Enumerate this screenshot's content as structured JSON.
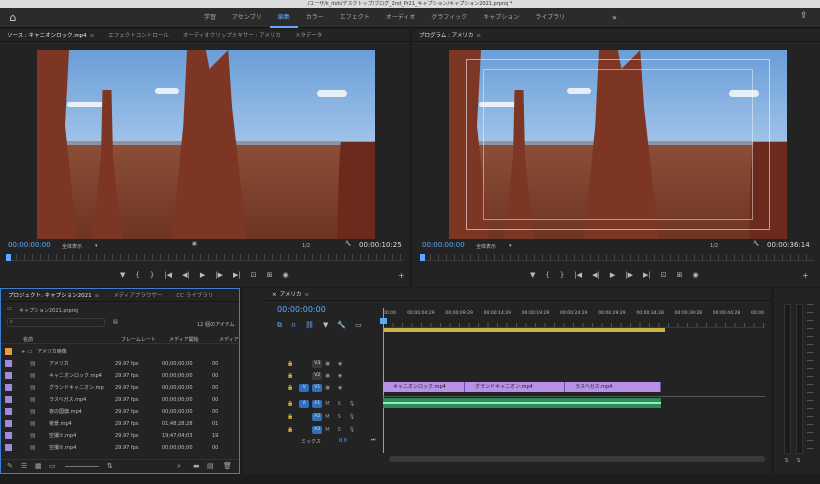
{
  "window": {
    "title": "/ユーザ/k_itoh/デスクトップ/ブログ_2nd_Pr21_キャプション/キャプション2021.prproj *"
  },
  "workspace": {
    "tabs": [
      "学習",
      "アセンブリ",
      "編集",
      "カラー",
      "エフェクト",
      "オーディオ",
      "グラフィック",
      "キャプション",
      "ライブラリ"
    ],
    "active": "編集",
    "more": "»"
  },
  "source_monitor": {
    "tabs": [
      "ソース : キャニオンロック.mp4",
      "エフェクトコントロール",
      "オーディオクリップミキサー : アメリカ",
      "メタデータ"
    ],
    "timecode_in": "00:00:00:00",
    "fit": "全体表示",
    "resolution": "1/2",
    "duration": "00:00:10:25"
  },
  "program_monitor": {
    "tab": "プログラム : アメリカ",
    "timecode_in": "00:00:00:00",
    "fit": "全体表示",
    "resolution": "1/2",
    "duration": "00:00:36:14"
  },
  "project": {
    "tabs": [
      "プロジェクト: キャプション2021",
      "メディアブラウザー",
      "CC ライブラリ"
    ],
    "file": "キャプション2021.prproj",
    "item_count": "12 個のアイテム",
    "columns": [
      "名前",
      "フレームレート",
      "メディア開始",
      "メディア"
    ],
    "rows": [
      {
        "name": "アメリカ映像",
        "fps": "",
        "start": "",
        "end": "",
        "color": "#e89b3a"
      },
      {
        "name": "アメリカ",
        "fps": "29.97 fps",
        "start": "00;00;00;00",
        "end": "00",
        "color": "#9f8ae0"
      },
      {
        "name": "キャニオンロック.mp4",
        "fps": "29.97 fps",
        "start": "00;00;00;00",
        "end": "00",
        "color": "#a18ad8"
      },
      {
        "name": "グランドキャニオン.mp",
        "fps": "29.97 fps",
        "start": "00;00;00;00",
        "end": "00",
        "color": "#a18ad8"
      },
      {
        "name": "ラスベガス.mp4",
        "fps": "29.97 fps",
        "start": "00;00;00;00",
        "end": "00",
        "color": "#a18ad8"
      },
      {
        "name": "夜の国旗.mp4",
        "fps": "29.97 fps",
        "start": "00;00;00;00",
        "end": "00",
        "color": "#a18ad8"
      },
      {
        "name": "夜景.mp4",
        "fps": "29.97 fps",
        "start": "01;48;28;28",
        "end": "01",
        "color": "#a18ad8"
      },
      {
        "name": "空撮①.mp4",
        "fps": "29.97 fps",
        "start": "19;47;04;03",
        "end": "19",
        "color": "#a18ad8"
      },
      {
        "name": "空撮②.mp4",
        "fps": "29.97 fps",
        "start": "00;00;00;00",
        "end": "00",
        "color": "#a18ad8"
      }
    ]
  },
  "timeline": {
    "tab": "アメリカ",
    "timecode": "00:00:00:00",
    "ruler": [
      "00:00",
      "00:00:04:29",
      "00:00:09:29",
      "00:00:14:29",
      "00:00:19:29",
      "00:00:24:29",
      "00:00:29:29",
      "00:00:34:28",
      "00:00:39:28",
      "00:00:44:28",
      "00:00"
    ],
    "tracks": [
      {
        "id": "V3",
        "kind": "video"
      },
      {
        "id": "V2",
        "kind": "video"
      },
      {
        "id": "V1",
        "kind": "video"
      },
      {
        "id": "A1",
        "kind": "audio"
      },
      {
        "id": "A2",
        "kind": "audio"
      },
      {
        "id": "A3",
        "kind": "audio"
      }
    ],
    "mix_label": "ミックス",
    "mix_value": "0.0",
    "clips": [
      "キャニオンロック.mp4",
      "グランドキャニオン.mp4",
      "ラスベガス.mp4"
    ]
  },
  "meter": {
    "labels": [
      "S",
      "S"
    ]
  },
  "colors": {
    "accent": "#5fa8ff",
    "clip_video": "#b990e8",
    "clip_audio": "#2e8a5c"
  }
}
